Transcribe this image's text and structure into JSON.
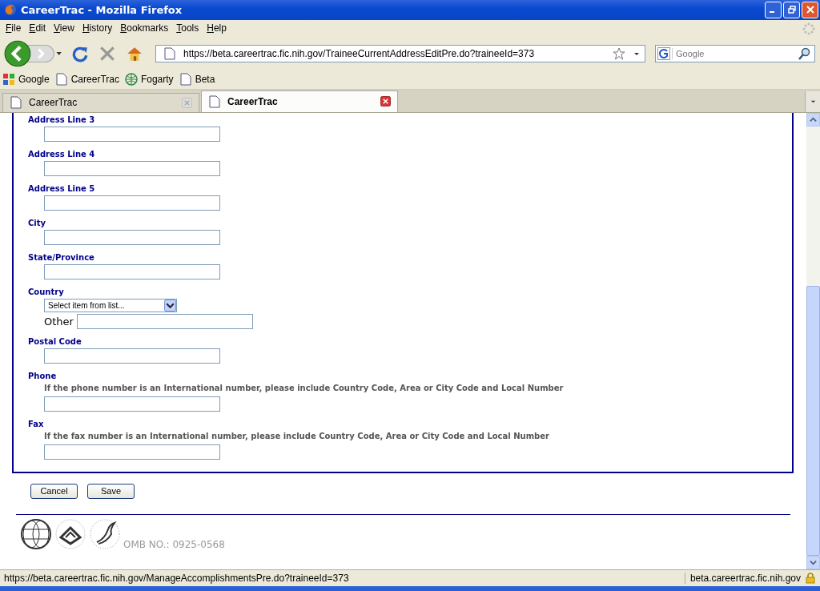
{
  "window": {
    "title": "CareerTrac - Mozilla Firefox"
  },
  "menu": [
    "File",
    "Edit",
    "View",
    "History",
    "Bookmarks",
    "Tools",
    "Help"
  ],
  "nav": {
    "url": "https://beta.careertrac.fic.nih.gov/TraineeCurrentAddressEditPre.do?traineeId=373",
    "search_placeholder": "Google"
  },
  "bookmarks": [
    {
      "label": "Google",
      "kind": "google"
    },
    {
      "label": "CareerTrac",
      "kind": "page"
    },
    {
      "label": "Fogarty",
      "kind": "globe"
    },
    {
      "label": "Beta",
      "kind": "page"
    }
  ],
  "tabs": [
    {
      "label": "CareerTrac",
      "selected": false
    },
    {
      "label": "CareerTrac",
      "selected": true
    }
  ],
  "form": {
    "fields": [
      {
        "label": "Address Line 3",
        "kind": "text"
      },
      {
        "label": "Address Line 4",
        "kind": "text"
      },
      {
        "label": "Address Line 5",
        "kind": "text"
      },
      {
        "label": "City",
        "kind": "text"
      },
      {
        "label": "State/Province",
        "kind": "text"
      },
      {
        "label": "Country",
        "kind": "select",
        "value": "Select item from list...",
        "other_label": "Other"
      },
      {
        "label": "Postal Code",
        "kind": "text"
      },
      {
        "label": "Phone",
        "kind": "text",
        "hint": "If the phone number is an International number, please include Country Code, Area or City Code and Local Number"
      },
      {
        "label": "Fax",
        "kind": "text",
        "hint": "If the fax number is an International number, please include Country Code, Area or City Code and Local Number"
      }
    ]
  },
  "buttons": [
    "Cancel",
    "Save"
  ],
  "footer": {
    "omb": "OMB NO.: 0925-0568"
  },
  "status_bar": {
    "url": "https://beta.careertrac.fic.nih.gov/ManageAccomplishmentsPre.do?traineeId=373",
    "domain": "beta.careertrac.fic.nih.gov"
  }
}
